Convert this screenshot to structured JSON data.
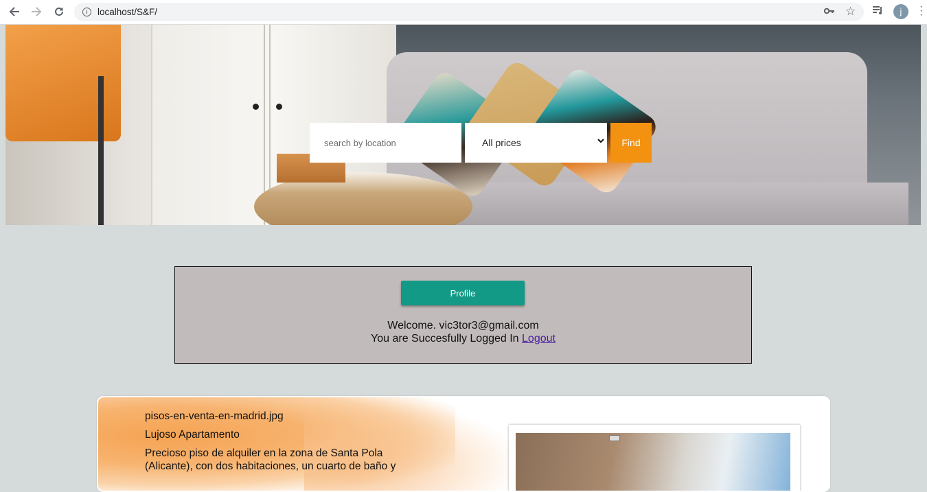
{
  "browser": {
    "url": "localhost/S&F/",
    "profile_initial": "j"
  },
  "search": {
    "placeholder": "search by location",
    "price_selected": "All prices",
    "find_label": "Find"
  },
  "profile_panel": {
    "profile_label": "Profile",
    "welcome_text": "Welcome. vic3tor3@gmail.com",
    "logged_in_text": "You are Succesfully Logged In",
    "logout_label": "Logout"
  },
  "listing": {
    "image_name": "pisos-en-venta-en-madrid.jpg",
    "title": "Lujoso Apartamento",
    "description_line1": "Precioso piso de alquiler en la zona de Santa Pola",
    "description_line2": "(Alicante), con dos habitaciones, un cuarto de baño y"
  },
  "colors": {
    "accent_orange": "#f39211",
    "profile_teal": "#129a86",
    "panel_bg": "#c2bbbb",
    "page_bg": "#d5dada"
  }
}
